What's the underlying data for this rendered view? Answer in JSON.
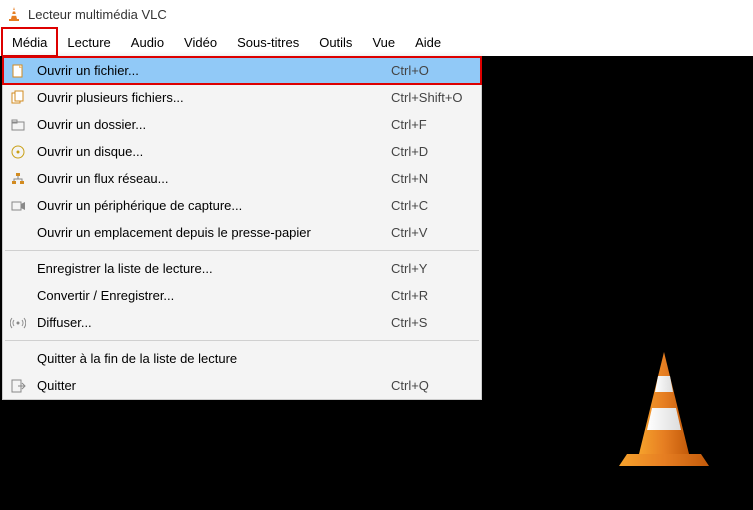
{
  "app": {
    "title": "Lecteur multimédia VLC",
    "icon": "vlc-cone-icon"
  },
  "menubar": [
    {
      "id": "media",
      "label": "Média",
      "active": true
    },
    {
      "id": "lecture",
      "label": "Lecture"
    },
    {
      "id": "audio",
      "label": "Audio"
    },
    {
      "id": "video",
      "label": "Vidéo"
    },
    {
      "id": "soustitres",
      "label": "Sous-titres"
    },
    {
      "id": "outils",
      "label": "Outils"
    },
    {
      "id": "vue",
      "label": "Vue"
    },
    {
      "id": "aide",
      "label": "Aide"
    }
  ],
  "dropdown": {
    "groups": [
      [
        {
          "icon": "file-icon",
          "label": "Ouvrir un fichier...",
          "shortcut": "Ctrl+O",
          "highlighted": true
        },
        {
          "icon": "files-icon",
          "label": "Ouvrir plusieurs fichiers...",
          "shortcut": "Ctrl+Shift+O"
        },
        {
          "icon": "folder-icon",
          "label": "Ouvrir un dossier...",
          "shortcut": "Ctrl+F"
        },
        {
          "icon": "disc-icon",
          "label": "Ouvrir un disque...",
          "shortcut": "Ctrl+D"
        },
        {
          "icon": "network-icon",
          "label": "Ouvrir un flux réseau...",
          "shortcut": "Ctrl+N"
        },
        {
          "icon": "capture-icon",
          "label": "Ouvrir un périphérique de capture...",
          "shortcut": "Ctrl+C"
        },
        {
          "icon": "",
          "label": "Ouvrir un emplacement depuis le presse-papier",
          "shortcut": "Ctrl+V"
        }
      ],
      [
        {
          "icon": "",
          "label": "Enregistrer la liste de lecture...",
          "shortcut": "Ctrl+Y"
        },
        {
          "icon": "",
          "label": "Convertir / Enregistrer...",
          "shortcut": "Ctrl+R"
        },
        {
          "icon": "stream-icon",
          "label": "Diffuser...",
          "shortcut": "Ctrl+S"
        }
      ],
      [
        {
          "icon": "",
          "label": "Quitter à la fin de la liste de lecture",
          "shortcut": ""
        },
        {
          "icon": "quit-icon",
          "label": "Quitter",
          "shortcut": "Ctrl+Q"
        }
      ]
    ]
  },
  "colors": {
    "highlight_bg": "#91c9f7",
    "highlight_outline": "#d00",
    "menu_bg": "#f4f4f4",
    "video_bg": "#000"
  }
}
